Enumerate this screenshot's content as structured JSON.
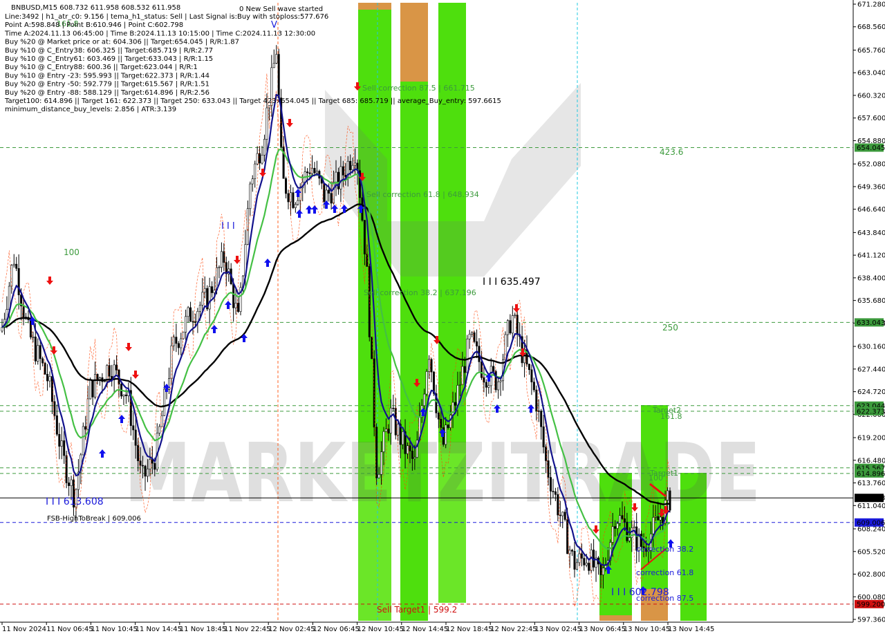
{
  "chart_data": {
    "type": "candlestick",
    "symbol": "BNBUSD,M15",
    "ohlc": "608.732 611.958 608.532 611.958",
    "info_lines": [
      "Line:3492 | h1_atr_c0: 9.156 | tema_h1_status: Sell | Last Signal is:Buy with stoploss:577.676",
      "Point A:598.848 | Point B:610.946 | Point C:602.798",
      "Time A:2024.11.13 06:45:00 | Time B:2024.11.13 10:15:00 | Time C:2024.11.13 12:30:00",
      "Buy %20 @ Market price or at: 604.306 || Target:654.045 | R/R:1.87",
      "Buy %10 @ C_Entry38: 606.325 || Target:685.719 | R/R:2.77",
      "Buy %10 @ C_Entry61: 603.469 || Target:633.043 | R/R:1.15",
      "Buy %10 @ C_Entry88: 600.36 || Target:623.044 | R/R:1",
      "Buy %10 @ Entry -23: 595.993 || Target:622.373 | R/R:1.44",
      "Buy %20 @ Entry -50: 592.779 || Target:615.567 | R/R:1.51",
      "Buy %20 @ Entry -88: 588.129 || Target:614.896 | R/R:2.56",
      "Target100: 614.896 || Target 161: 622.373 || Target 250: 633.043 || Target 423: 654.045 || Target 685: 685.719 || average_Buy_entry: 597.6615",
      "minimum_distance_buy_levels: 2.856 | ATR:3.139"
    ],
    "wave_banner": "0 New Sell wave started",
    "y_ticks": [
      "671.280",
      "668.560",
      "665.760",
      "663.040",
      "660.320",
      "657.600",
      "654.880",
      "652.080",
      "649.360",
      "646.640",
      "643.840",
      "641.120",
      "638.400",
      "635.680",
      "632.960",
      "630.160",
      "627.440",
      "624.720",
      "622.000",
      "619.200",
      "616.480",
      "613.760",
      "611.040",
      "608.240",
      "605.520",
      "602.800",
      "600.080",
      "597.360"
    ],
    "x_ticks": [
      "11 Nov 2024",
      "11 Nov 06:45",
      "11 Nov 10:45",
      "11 Nov 14:45",
      "11 Nov 18:45",
      "11 Nov 22:45",
      "12 Nov 02:45",
      "12 Nov 06:45",
      "12 Nov 10:45",
      "12 Nov 14:45",
      "12 Nov 18:45",
      "12 Nov 22:45",
      "13 Nov 02:45",
      "13 Nov 06:45",
      "13 Nov 10:45",
      "13 Nov 14:45"
    ],
    "ylim": [
      597.0,
      671.6
    ],
    "levels": [
      {
        "value": 654.045,
        "label": "654.045",
        "color": "#3c9a3c",
        "style": "dashed"
      },
      {
        "value": 633.043,
        "label": "633.043",
        "color": "#3c9a3c",
        "style": "dashed"
      },
      {
        "value": 623.044,
        "label": "623.044",
        "color": "#3c9a3c",
        "style": "dashed"
      },
      {
        "value": 622.373,
        "label": "622.373",
        "color": "#3c9a3c",
        "style": "dashed"
      },
      {
        "value": 615.567,
        "label": "615.567",
        "color": "#3c9a3c",
        "style": "dashed"
      },
      {
        "value": 614.896,
        "label": "614.896",
        "color": "#3c9a3c",
        "style": "dashed"
      },
      {
        "value": 611.958,
        "label": "611.958",
        "color": "#000000",
        "style": "solid-current"
      },
      {
        "value": 609.006,
        "label": "609.006",
        "color": "#1a1adb",
        "style": "dashed"
      },
      {
        "value": 599.2,
        "label": "599.200",
        "color": "#d01010",
        "style": "dashed"
      }
    ],
    "annotations": [
      {
        "text": "423.6",
        "color": "#3c9a3c"
      },
      {
        "text": "250",
        "color": "#3c9a3c"
      },
      {
        "text": "100",
        "color": "#3c9a3c"
      },
      {
        "text": "161.8",
        "color": "#3c9a3c"
      },
      {
        "text": "Target2",
        "color": "#3c9a3c"
      },
      {
        "text": "Target1",
        "color": "#3c9a3c"
      },
      {
        "text": "100",
        "color": "#3c9a3c"
      },
      {
        "text": "161.8",
        "color": "#3c9a3c"
      },
      {
        "text": "Sell correction 87.5 | 661.715",
        "color": "#3c9a3c"
      },
      {
        "text": "Sell correction 61.8 | 648.934",
        "color": "#3c9a3c"
      },
      {
        "text": "Sell correction 38.2 | 637.196",
        "color": "#3c9a3c"
      },
      {
        "text": "I I I 635.497",
        "color": "#000000"
      },
      {
        "text": "I I I 613.608",
        "color": "#1a1adb"
      },
      {
        "text": "I I I 602.798",
        "color": "#1a1adb"
      },
      {
        "text": "FSB-HighToBreak | 609.006",
        "color": "#000000"
      },
      {
        "text": "Sell Target1 | 599.2",
        "color": "#d01010"
      },
      {
        "text": "correction 38.2",
        "color": "#1a1adb"
      },
      {
        "text": "correction 61.8",
        "color": "#1a1adb"
      },
      {
        "text": "correction 87.5",
        "color": "#1a1adb"
      },
      {
        "text": "I I I",
        "color": "#1a1adb"
      },
      {
        "text": "V",
        "color": "#1a1adb"
      }
    ],
    "colors": {
      "candle": "#000000",
      "ema_fast": "#12128c",
      "ema_mid": "#44c044",
      "ema_slow": "#000000",
      "zone_green": "#44dd00",
      "zone_orange": "#e0904a",
      "buy_arrow": "#1010ee",
      "sell_arrow": "#ee1010",
      "stop_line": "#ff4000"
    }
  }
}
